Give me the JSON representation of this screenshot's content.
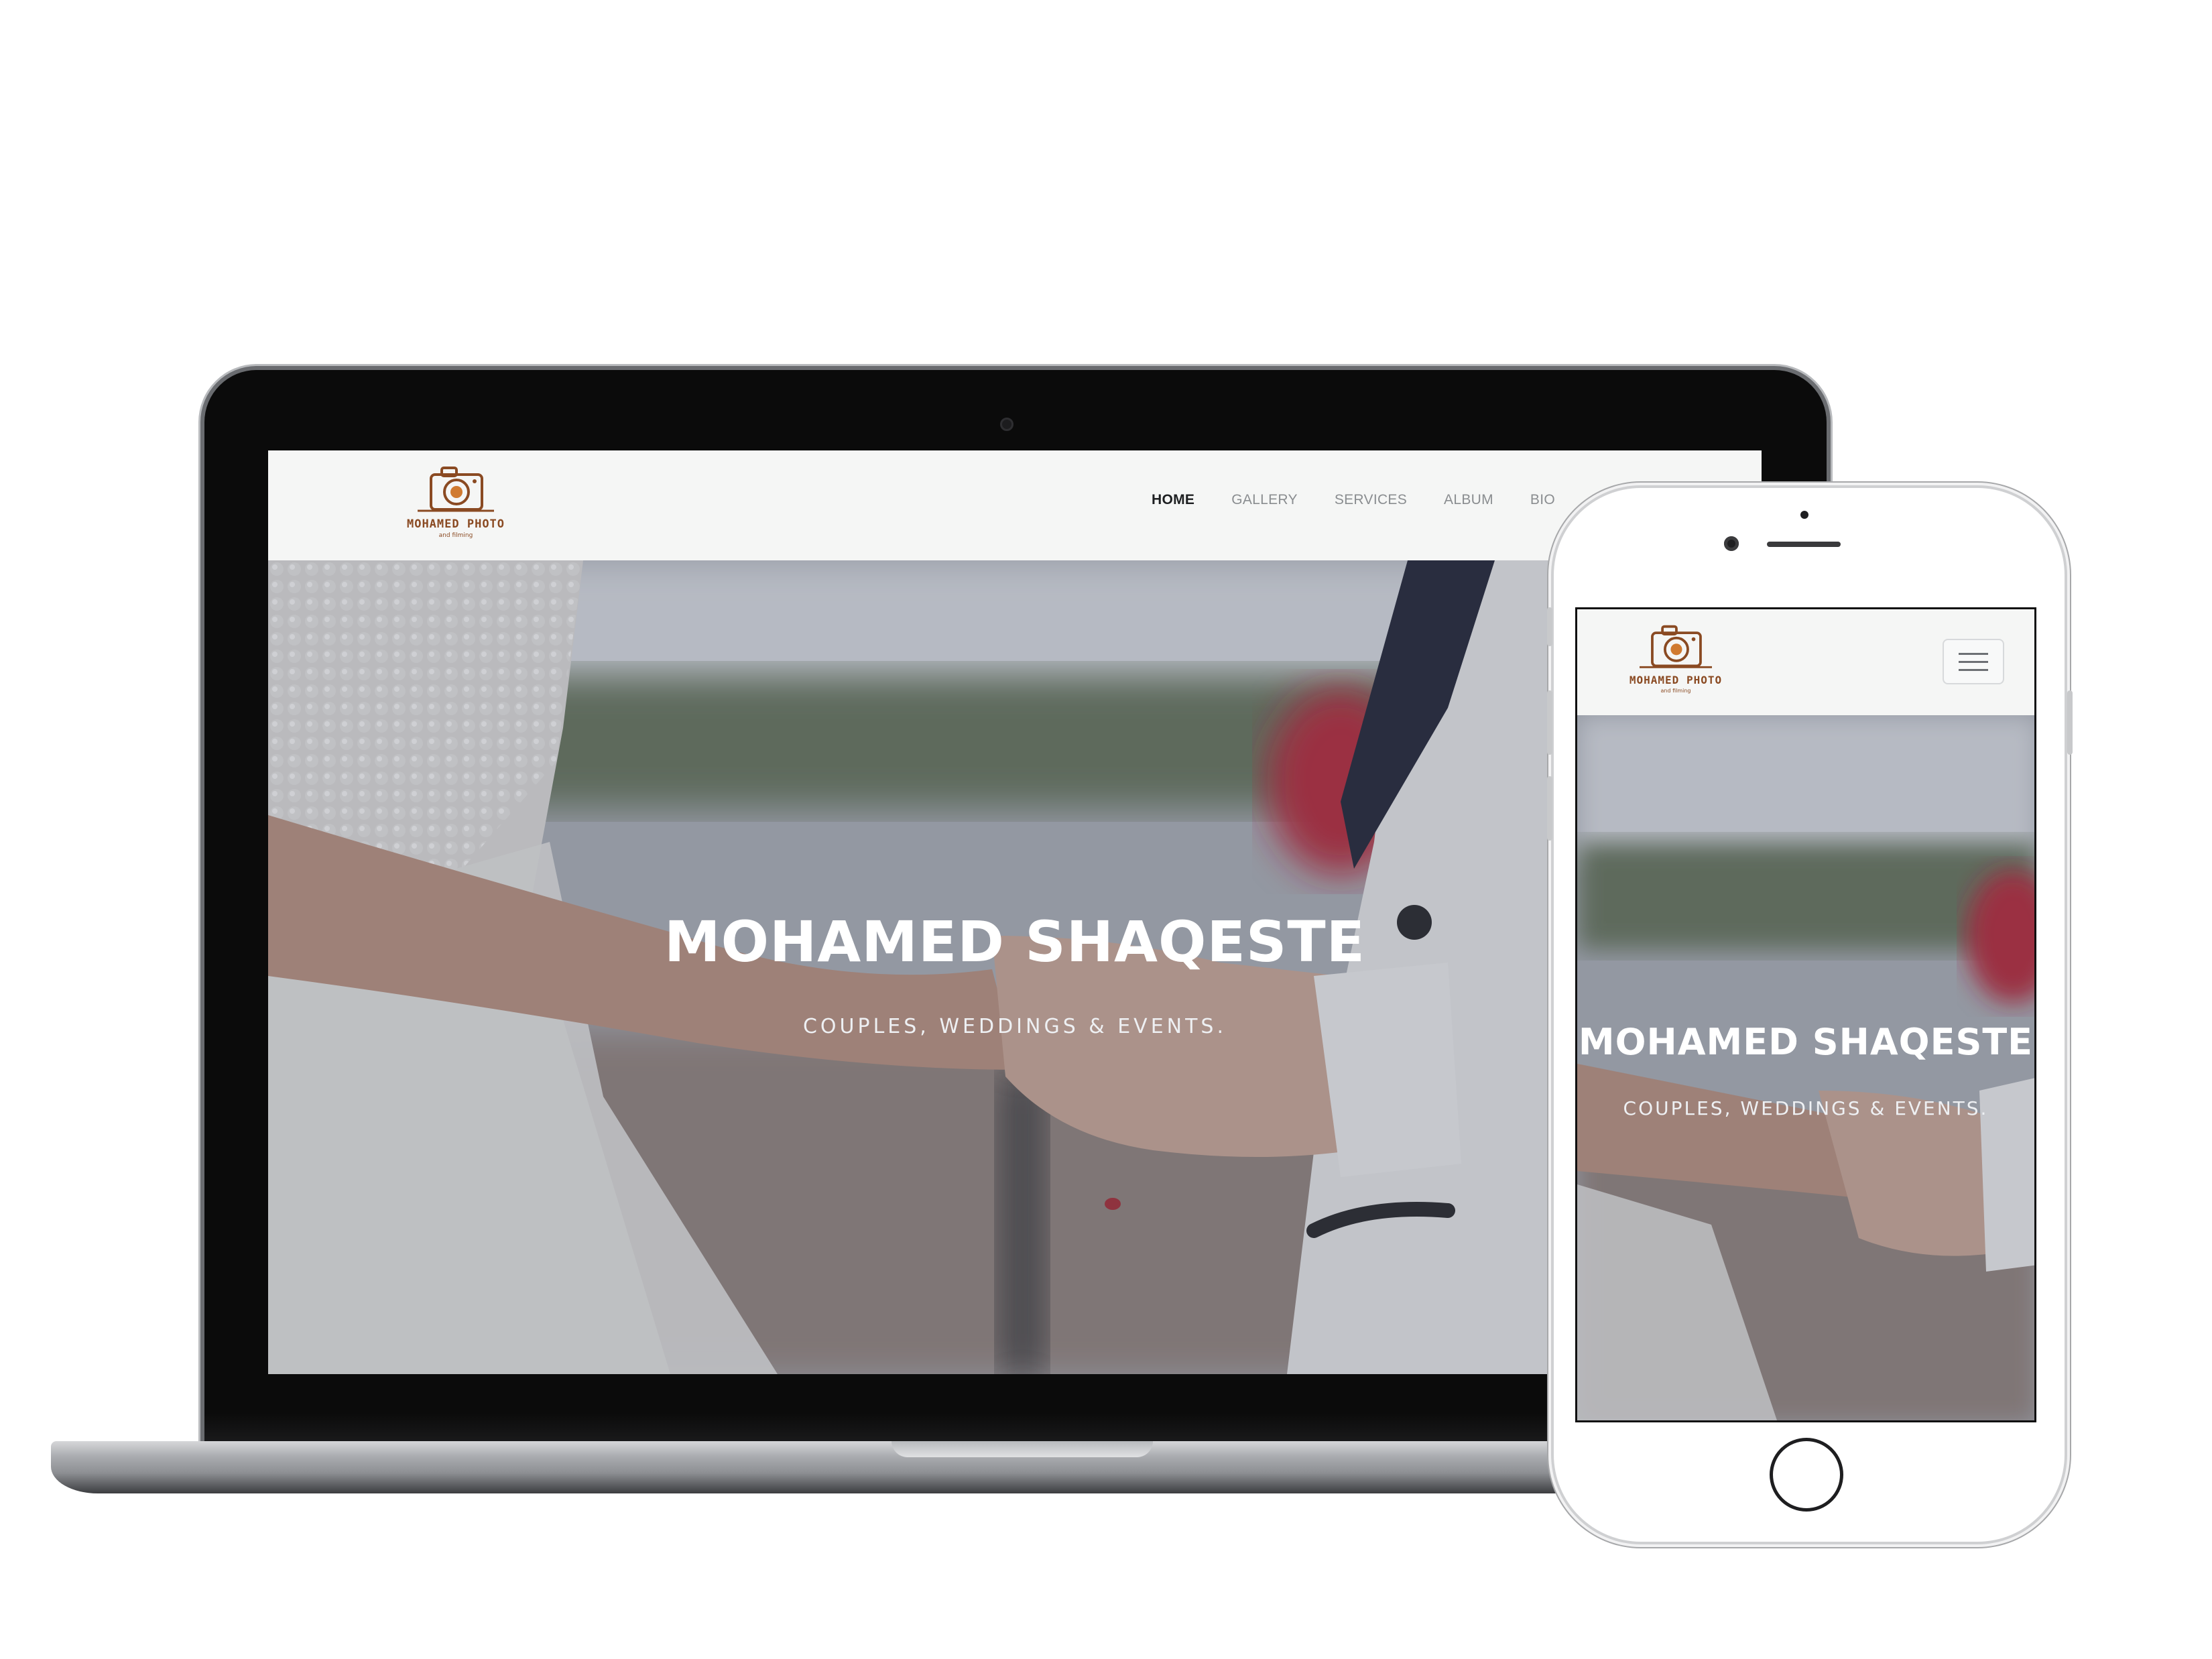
{
  "brand": {
    "name": "MOHAMED PHOTO",
    "tagline": "and filming",
    "color": "#8a4a22"
  },
  "nav": {
    "items": [
      {
        "label": "HOME",
        "active": true
      },
      {
        "label": "GALLERY",
        "active": false
      },
      {
        "label": "SERVICES",
        "active": false
      },
      {
        "label": "ALBUM",
        "active": false
      },
      {
        "label": "BIO",
        "active": false
      }
    ]
  },
  "hero": {
    "title": "MOHAMED SHAQESTE",
    "subtitle": "COUPLES, WEDDINGS & EVENTS."
  },
  "mobile": {
    "menu_icon": "hamburger-menu-icon"
  },
  "icons": {
    "logo": "camera-icon"
  }
}
